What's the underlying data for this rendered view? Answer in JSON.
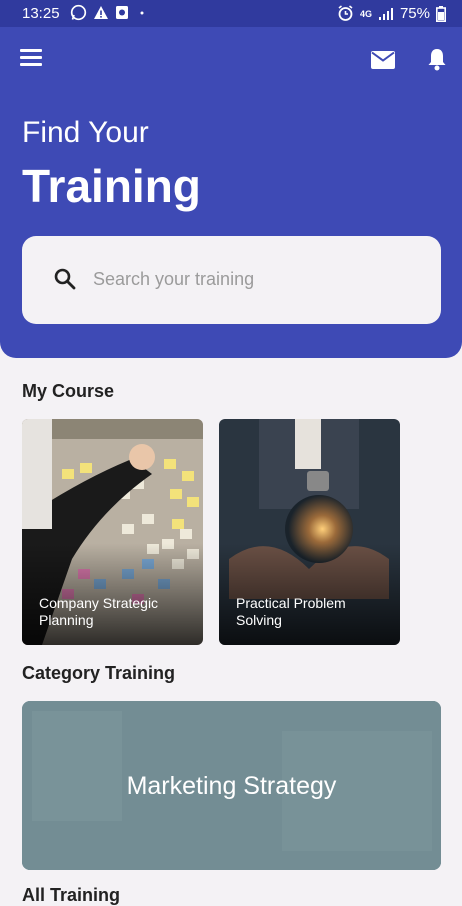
{
  "status_bar": {
    "time": "13:25",
    "network": "4G",
    "battery": "75%"
  },
  "header": {
    "title_line1": "Find Your",
    "title_line2": "Training"
  },
  "search": {
    "placeholder": "Search your training"
  },
  "my_course": {
    "title": "My Course",
    "items": [
      {
        "label": "Company Strategic Planning"
      },
      {
        "label": "Practical Problem Solving"
      }
    ]
  },
  "category": {
    "title": "Category Training",
    "items": [
      {
        "label": "Marketing Strategy"
      }
    ]
  },
  "all_training": {
    "title": "All Training"
  },
  "icons": [
    "menu-icon",
    "mail-icon",
    "bell-icon",
    "search-icon",
    "whatsapp-icon",
    "alert-icon",
    "alarm-icon",
    "signal-icon",
    "battery-icon"
  ],
  "colors": {
    "primary": "#3e4ab5",
    "status_bar": "#303a9e",
    "background": "#f4f2f5",
    "category_overlay": "#6f8a93"
  }
}
